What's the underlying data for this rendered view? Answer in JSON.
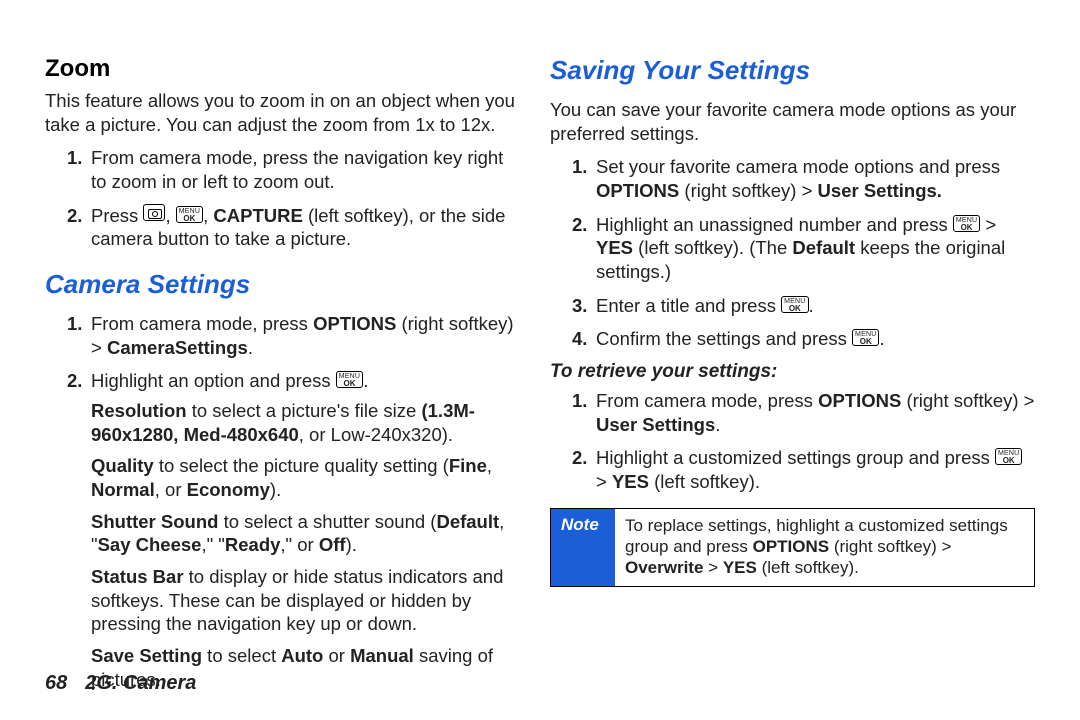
{
  "footer": {
    "page": "68",
    "chapter": "2G. Camera"
  },
  "left": {
    "zoom": {
      "heading": "Zoom",
      "intro": "This feature allows you to zoom in on an object when you take a picture. You can adjust the zoom from 1x to 12x.",
      "step1": "From camera mode, press the navigation key right to zoom in or left to zoom out.",
      "step2_a": "Press ",
      "step2_b": ", ",
      "step2_c": ", ",
      "step2_bold": "CAPTURE",
      "step2_d": " (left softkey), or the side camera button to take a picture."
    },
    "camset": {
      "heading": "Camera Settings",
      "step1_a": "From camera mode, press ",
      "step1_bold1": "OPTIONS",
      "step1_b": " (right softkey) > ",
      "step1_bold2": "CameraSettings",
      "step1_c": ".",
      "step2_a": "Highlight an option and press ",
      "step2_b": ".",
      "res_a": "Resolution",
      "res_b": " to select a picture's file size ",
      "res_c": "(1.3M-960x1280, Med-480x640",
      "res_d": ", or ",
      "res_e": "Low-240x320",
      "res_f": ").",
      "qual_a": "Quality",
      "qual_b": " to select the picture quality setting (",
      "qual_c": "Fine",
      "qual_d": ", ",
      "qual_e": "Normal",
      "qual_f": ", or ",
      "qual_g": "Economy",
      "qual_h": ").",
      "shut_a": "Shutter Sound",
      "shut_b": " to select a shutter sound (",
      "shut_c": "Default",
      "shut_d": ", \"",
      "shut_e": "Say Cheese",
      "shut_f": ",\" \"",
      "shut_g": "Ready",
      "shut_h": ",\" or ",
      "shut_i": "Off",
      "shut_j": ").",
      "stat_a": "Status Bar",
      "stat_b": " to display or hide status indicators and softkeys. These can be displayed or hidden by pressing the navigation key up or down.",
      "save_a": "Save Setting",
      "save_b": " to select ",
      "save_c": "Auto",
      "save_d": " or ",
      "save_e": "Manual",
      "save_f": " saving of pictures."
    }
  },
  "right": {
    "saving": {
      "heading": "Saving Your Settings",
      "intro": "You can save your favorite camera mode options as your preferred settings.",
      "s1_a": "Set your favorite camera mode options and press ",
      "s1_b": "OPTIONS",
      "s1_c": " (right softkey) > ",
      "s1_d": "User Settings.",
      "s2_a": "Highlight an unassigned number and press ",
      "s2_b": " > ",
      "s2_c": "YES",
      "s2_d": " (left softkey). (The ",
      "s2_e": "Default",
      "s2_f": " keeps the original settings.)",
      "s3_a": "Enter a title and press ",
      "s3_b": ".",
      "s4_a": "Confirm the settings and press ",
      "s4_b": "."
    },
    "retrieve": {
      "heading": "To retrieve your settings:",
      "r1_a": "From camera mode, press ",
      "r1_b": "OPTIONS",
      "r1_c": " (right softkey) > ",
      "r1_d": "User Settings",
      "r1_e": ".",
      "r2_a": "Highlight a customized settings group and press ",
      "r2_b": " > ",
      "r2_c": "YES",
      "r2_d": " (left softkey)."
    },
    "note": {
      "label": "Note",
      "n_a": "To replace settings, highlight a customized settings group and press ",
      "n_b": "OPTIONS",
      "n_c": " (right softkey) > ",
      "n_d": "Overwrite",
      "n_e": " > ",
      "n_f": "YES",
      "n_g": " (left softkey)."
    }
  },
  "key": {
    "menu": "MENU",
    "ok": "OK"
  }
}
